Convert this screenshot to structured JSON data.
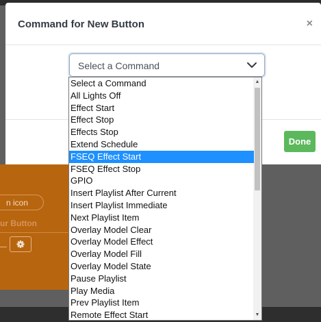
{
  "modal": {
    "title": "Command for New Button",
    "close_glyph": "×",
    "done_label": "Done"
  },
  "background": {
    "pill_text": "n icon",
    "faded_text": "ur Button",
    "gear_icon": "gear-icon"
  },
  "select": {
    "value": "Select a Command",
    "chevron_icon": "chevron-down-icon"
  },
  "options": [
    "Select a Command",
    "All Lights Off",
    "Effect Start",
    "Effect Stop",
    "Effects Stop",
    "Extend Schedule",
    "FSEQ Effect Start",
    "FSEQ Effect Stop",
    "GPIO",
    "Insert Playlist After Current",
    "Insert Playlist Immediate",
    "Next Playlist Item",
    "Overlay Model Clear",
    "Overlay Model Effect",
    "Overlay Model Fill",
    "Overlay Model State",
    "Pause Playlist",
    "Play Media",
    "Prev Playlist Item",
    "Remote Effect Start"
  ],
  "selected_index": 6,
  "colors": {
    "selected": "#1e90ff",
    "done": "#5cb85c",
    "panel": "#b8650f"
  }
}
